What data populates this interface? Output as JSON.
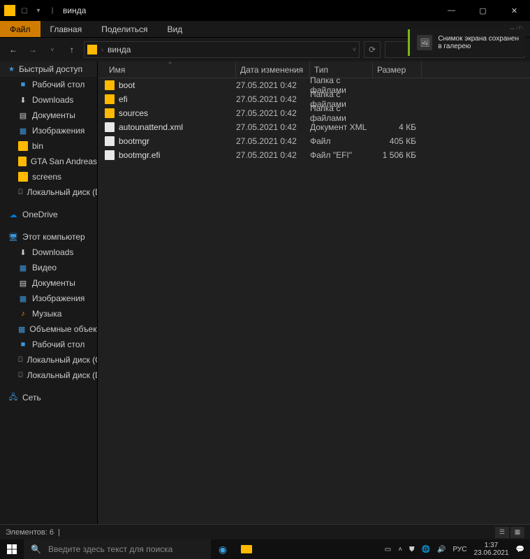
{
  "titlebar": {
    "title": "винда"
  },
  "ribbon": {
    "file": "Файл",
    "home": "Главная",
    "share": "Поделиться",
    "view": "Вид"
  },
  "breadcrumb": {
    "current": "винда"
  },
  "toast": {
    "line1": "Снимок экрана сохранен",
    "line2": "в галерею"
  },
  "sidebar": {
    "quick": "Быстрый доступ",
    "quick_items": [
      {
        "label": "Рабочий стол",
        "icon": "desk"
      },
      {
        "label": "Downloads",
        "icon": "dl"
      },
      {
        "label": "Документы",
        "icon": "doc"
      },
      {
        "label": "Изображения",
        "icon": "pic"
      },
      {
        "label": "bin",
        "icon": "folder"
      },
      {
        "label": "GTA San Andreas",
        "icon": "folder"
      },
      {
        "label": "screens",
        "icon": "folder"
      },
      {
        "label": "Локальный диск (D:)",
        "icon": "disk"
      }
    ],
    "onedrive": "OneDrive",
    "thispc": "Этот компьютер",
    "pc_items": [
      {
        "label": "Downloads",
        "icon": "dl"
      },
      {
        "label": "Видео",
        "icon": "pic"
      },
      {
        "label": "Документы",
        "icon": "doc"
      },
      {
        "label": "Изображения",
        "icon": "pic"
      },
      {
        "label": "Музыка",
        "icon": "music"
      },
      {
        "label": "Объемные объекты",
        "icon": "pic"
      },
      {
        "label": "Рабочий стол",
        "icon": "desk"
      },
      {
        "label": "Локальный диск (C:)",
        "icon": "disk"
      },
      {
        "label": "Локальный диск (D:)",
        "icon": "disk"
      }
    ],
    "network": "Сеть"
  },
  "columns": {
    "name": "Имя",
    "date": "Дата изменения",
    "type": "Тип",
    "size": "Размер"
  },
  "files": [
    {
      "icon": "fld",
      "name": "boot",
      "date": "27.05.2021 0:42",
      "type": "Папка с файлами",
      "size": ""
    },
    {
      "icon": "fld",
      "name": "efi",
      "date": "27.05.2021 0:42",
      "type": "Папка с файлами",
      "size": ""
    },
    {
      "icon": "fld",
      "name": "sources",
      "date": "27.05.2021 0:42",
      "type": "Папка с файлами",
      "size": ""
    },
    {
      "icon": "fil",
      "name": "autounattend.xml",
      "date": "27.05.2021 0:42",
      "type": "Документ XML",
      "size": "4 КБ"
    },
    {
      "icon": "fil",
      "name": "bootmgr",
      "date": "27.05.2021 0:42",
      "type": "Файл",
      "size": "405 КБ"
    },
    {
      "icon": "fil",
      "name": "bootmgr.efi",
      "date": "27.05.2021 0:42",
      "type": "Файл \"EFI\"",
      "size": "1 506 КБ"
    }
  ],
  "status": {
    "text": "Элементов: 6"
  },
  "taskbar": {
    "search_placeholder": "Введите здесь текст для поиска",
    "lang": "РУС",
    "time": "1:37",
    "date": "23.06.2021"
  }
}
